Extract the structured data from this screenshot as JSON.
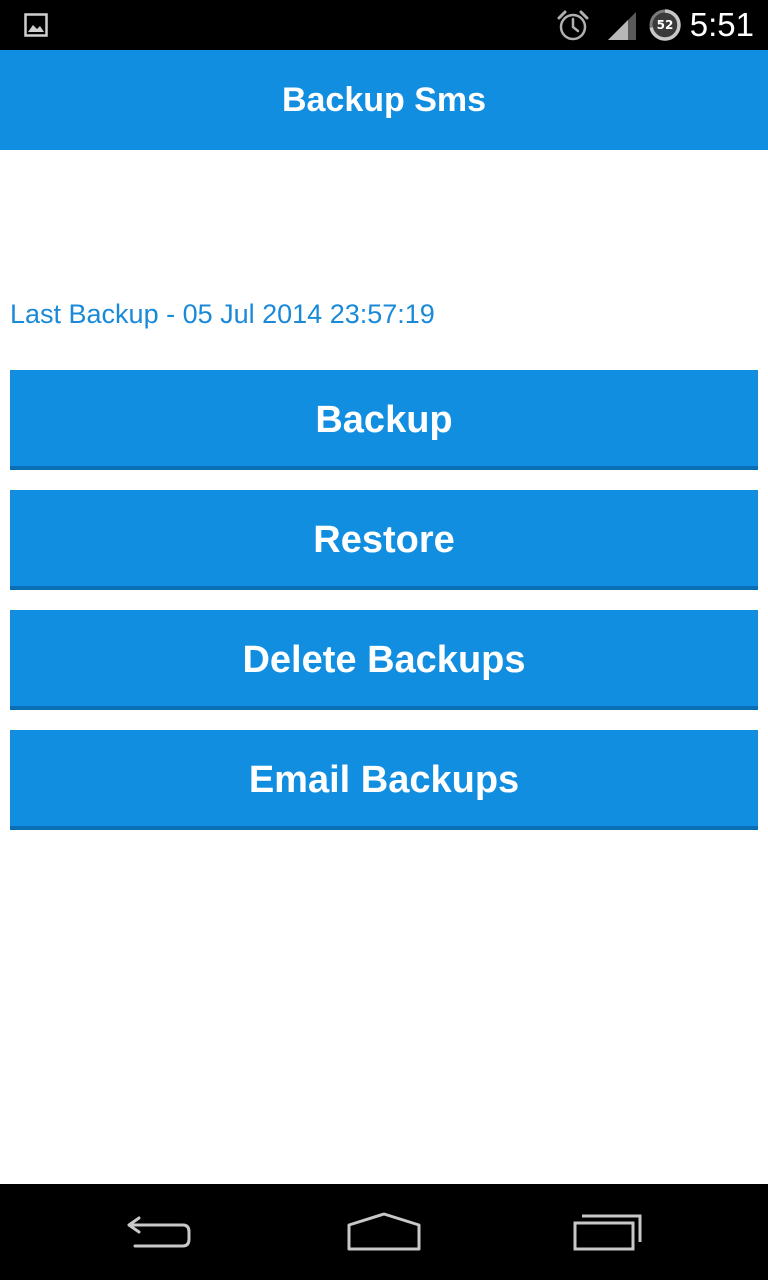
{
  "status_bar": {
    "time": "5:51",
    "battery_level": "52",
    "icons": [
      "gallery-icon",
      "alarm-icon",
      "signal-icon",
      "battery-icon"
    ]
  },
  "app_bar": {
    "title": "Backup Sms"
  },
  "main": {
    "last_backup": "Last Backup - 05 Jul 2014 23:57:19",
    "buttons": {
      "backup": "Backup",
      "restore": "Restore",
      "delete": "Delete Backups",
      "email": "Email Backups"
    }
  },
  "nav_bar": {
    "icons": [
      "back-icon",
      "home-icon",
      "recents-icon"
    ]
  },
  "colors": {
    "accent": "#118ee0",
    "accent_dark": "#0a6fb5",
    "text_accent": "#1a8ad8",
    "status_bar": "#000000",
    "background": "#ffffff"
  }
}
